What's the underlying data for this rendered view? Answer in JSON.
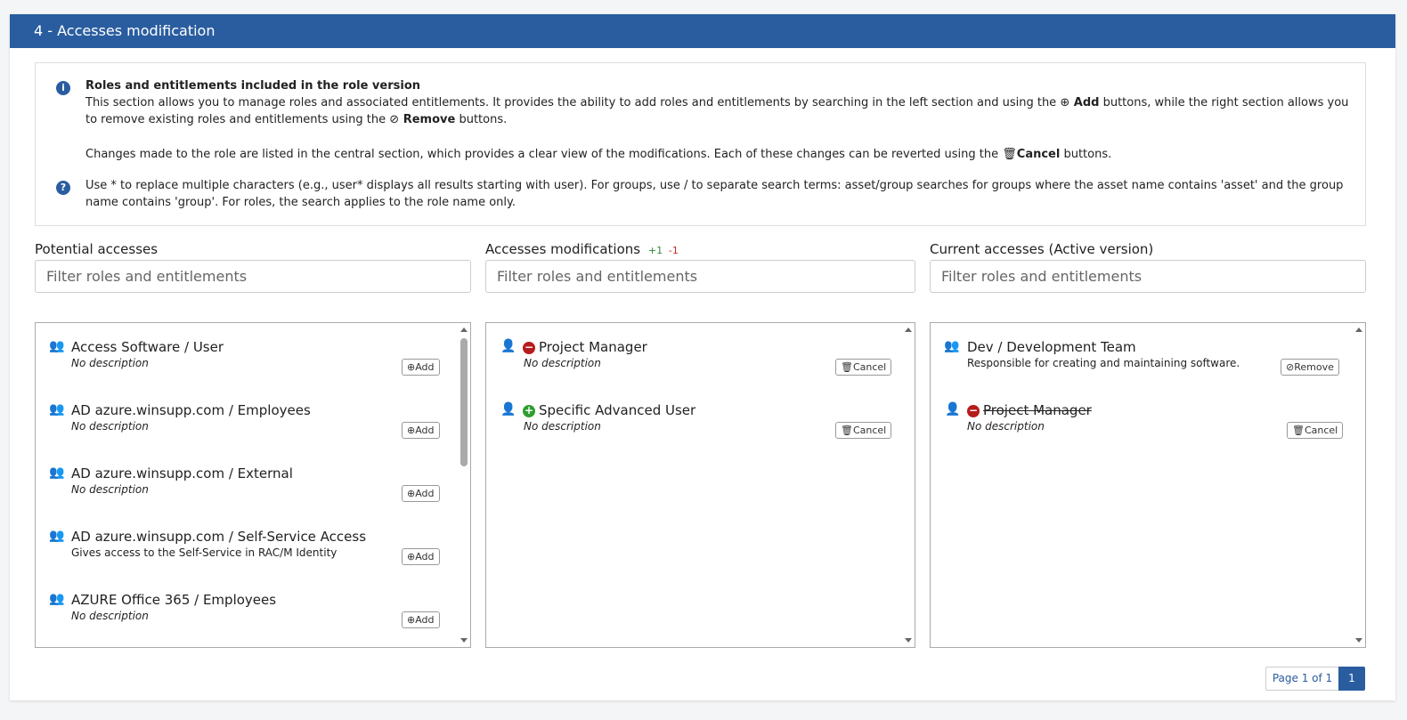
{
  "section": {
    "title": "4 - Accesses modification"
  },
  "info": {
    "title": "Roles and entitlements included in the role version",
    "p1_before_add": "This section allows you to manage roles and associated entitlements. It provides the ability to add roles and entitlements by searching in the left section and using the",
    "add_label": "Add",
    "p1_between": "buttons, while the right section allows you to remove existing roles and entitlements using the",
    "remove_label": "Remove",
    "p1_after": "buttons.",
    "p2_before": "Changes made to the role are listed in the central section, which provides a clear view of the modifications. Each of these changes can be reverted using the",
    "cancel_label": "Cancel",
    "p2_after": "buttons.",
    "help_text": "Use * to replace multiple characters (e.g., user* displays all results starting with user). For groups, use / to separate search terms: asset/group searches for groups where the asset name contains 'asset' and the group name contains 'group'. For roles, the search applies to the role name only."
  },
  "potential": {
    "title": "Potential accesses",
    "filter_placeholder": "Filter roles and entitlements",
    "items": [
      {
        "name": "Access Software / User",
        "desc": "No description",
        "button": "Add"
      },
      {
        "name": "AD azure.winsupp.com / Employees",
        "desc": "No description",
        "button": "Add"
      },
      {
        "name": "AD azure.winsupp.com / External",
        "desc": "No description",
        "button": "Add"
      },
      {
        "name": "AD azure.winsupp.com / Self-Service Access",
        "desc": "Gives access to the Self-Service in RAC/M Identity",
        "button": "Add"
      },
      {
        "name": "AZURE Office 365 / Employees",
        "desc": "No description",
        "button": "Add"
      }
    ]
  },
  "modifications": {
    "title": "Accesses modifications",
    "plus_count": "+1",
    "minus_count": "-1",
    "filter_placeholder": "Filter roles and entitlements",
    "items": [
      {
        "name": "Project Manager",
        "desc": "No description",
        "button": "Cancel",
        "status": "removed"
      },
      {
        "name": "Specific Advanced User",
        "desc": "No description",
        "button": "Cancel",
        "status": "added"
      }
    ]
  },
  "current": {
    "title": "Current accesses (Active version)",
    "filter_placeholder": "Filter roles and entitlements",
    "items": [
      {
        "name": "Dev / Development Team",
        "desc": "Responsible for creating and maintaining software.",
        "button": "Remove"
      },
      {
        "name": "Project Manager",
        "desc": "No description",
        "button": "Cancel",
        "status": "removed"
      }
    ]
  },
  "pagination": {
    "label": "Page 1 of 1",
    "current": "1"
  },
  "colors": {
    "primary": "#2a5d9f",
    "added": "#2e9e2e",
    "removed": "#b71c1c"
  }
}
